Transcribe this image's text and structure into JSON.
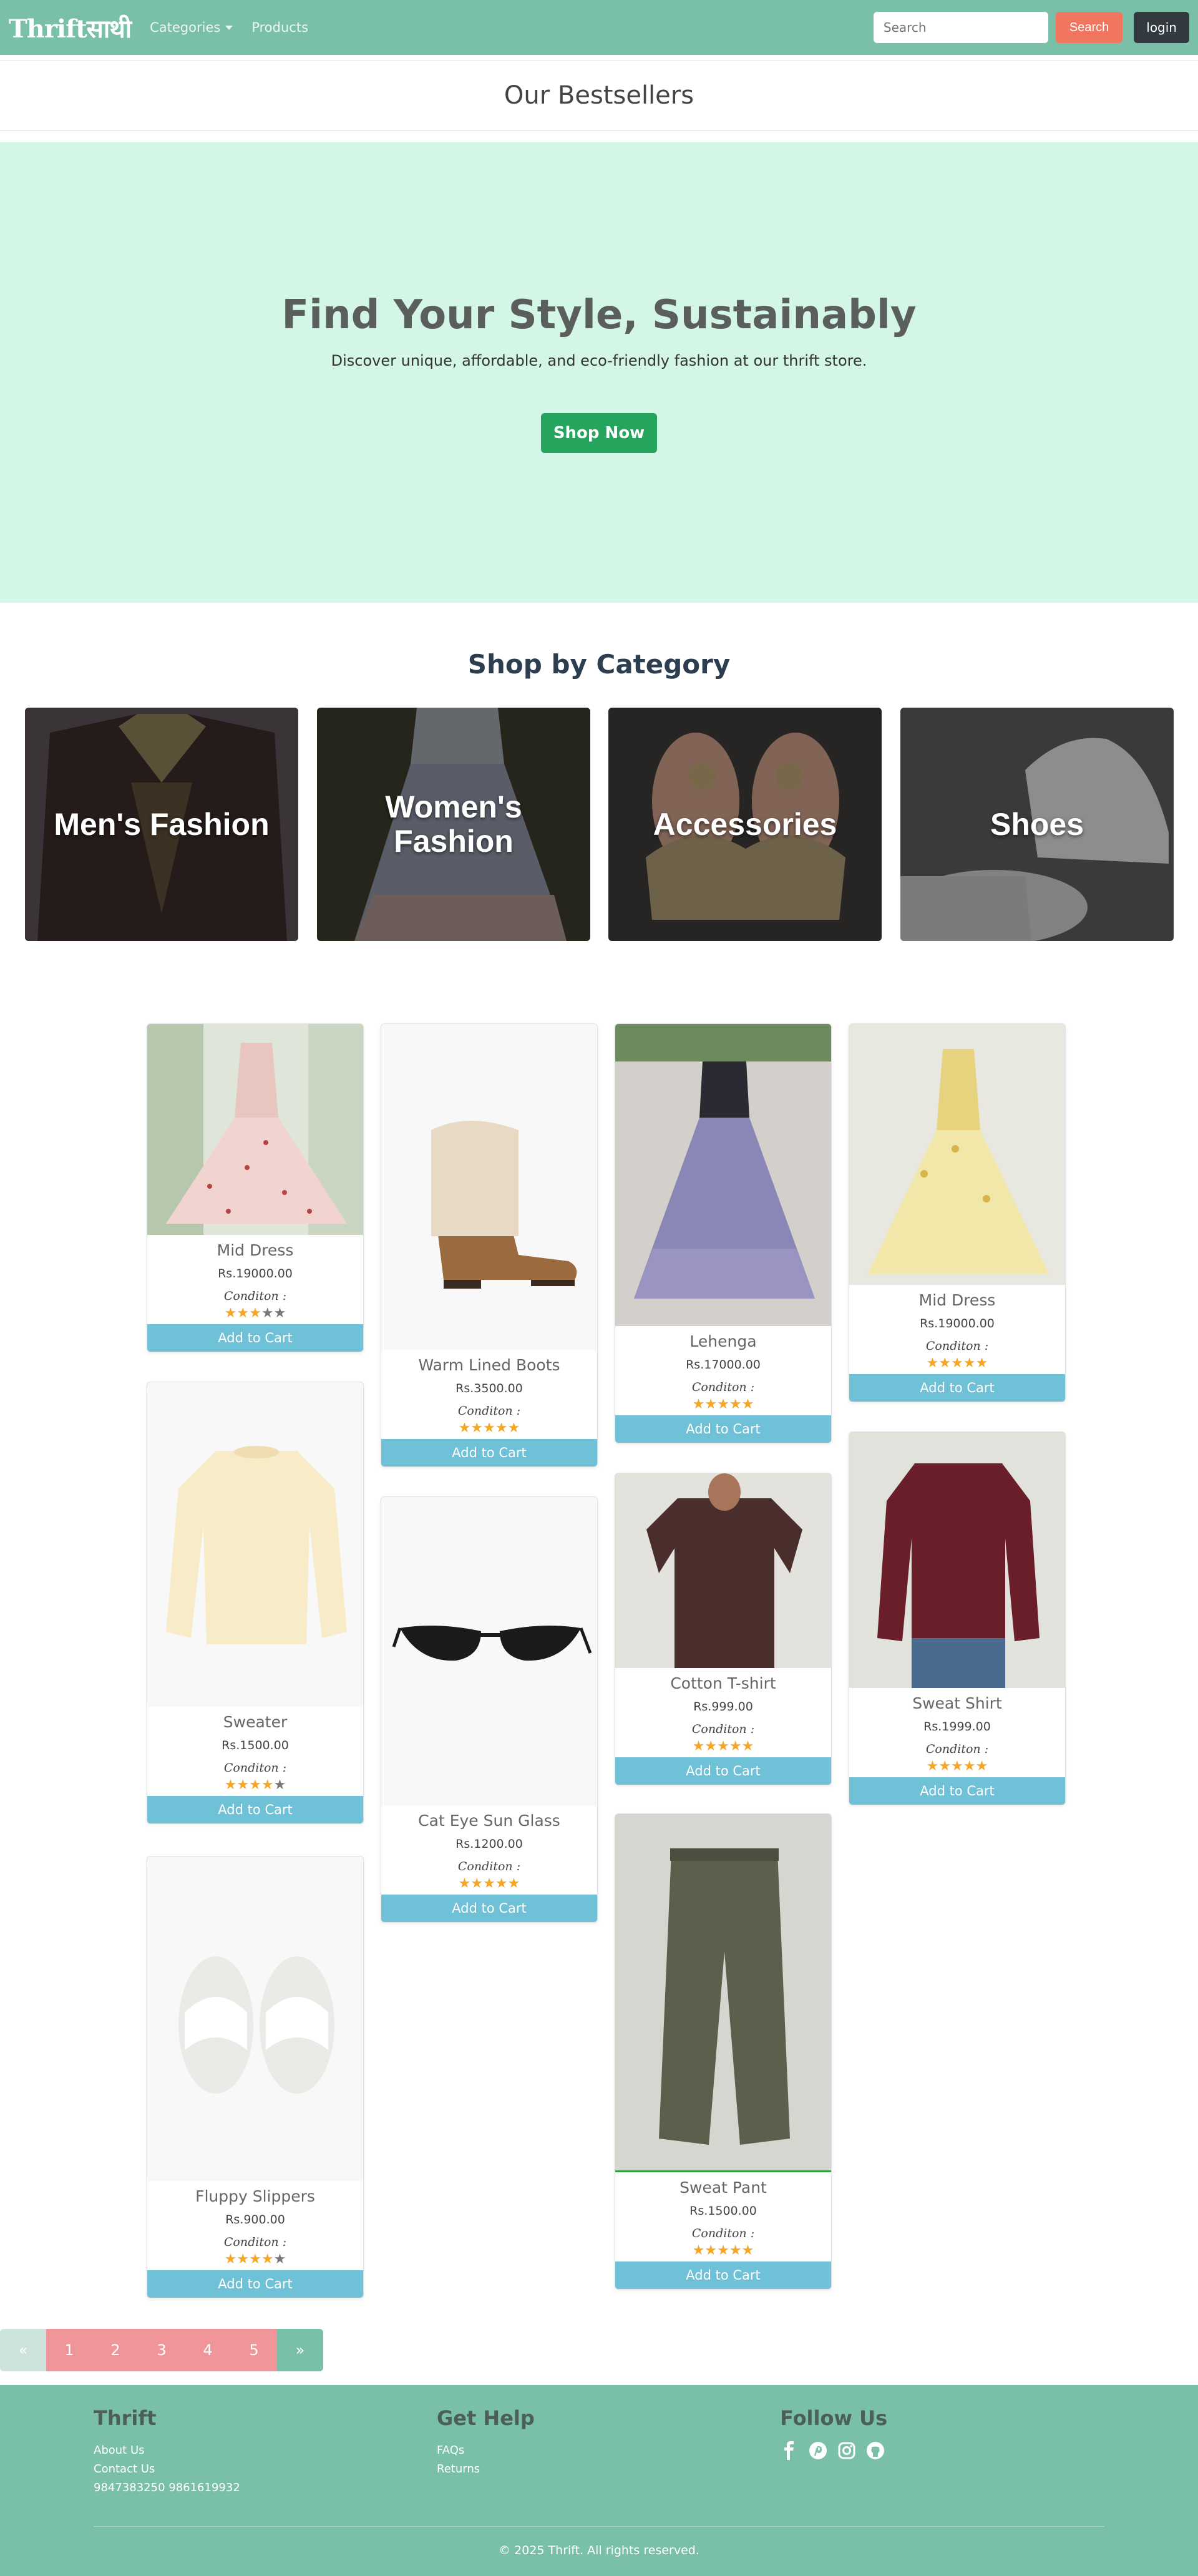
{
  "navbar": {
    "brand": "Thriftसाथी",
    "categories_label": "Categories",
    "products_label": "Products",
    "search_placeholder": "Search",
    "search_button": "Search",
    "login_button": "login"
  },
  "bestsellers_title": "Our Bestsellers",
  "hero": {
    "title": "Find Your Style, Sustainably",
    "subtitle": "Discover unique, affordable, and eco-friendly fashion at our thrift store.",
    "cta": "Shop Now"
  },
  "categories": {
    "title": "Shop by Category",
    "items": [
      {
        "label": "Men's Fashion",
        "icon": "jacket-photo"
      },
      {
        "label": "Women's Fashion",
        "icon": "lehenga-photo"
      },
      {
        "label": "Accessories",
        "icon": "earrings-photo"
      },
      {
        "label": "Shoes",
        "icon": "sneakers-photo"
      }
    ]
  },
  "products": [
    {
      "name": "Mid Dress",
      "price": "Rs.19000.00",
      "condition": "Conditon :",
      "rating": 3,
      "button": "Add to Cart"
    },
    {
      "name": "Sweater",
      "price": "Rs.1500.00",
      "condition": "Conditon :",
      "rating": 4,
      "button": "Add to Cart"
    },
    {
      "name": "Fluppy Slippers",
      "price": "Rs.900.00",
      "condition": "Conditon :",
      "rating": 4,
      "button": "Add to Cart"
    },
    {
      "name": "Warm Lined Boots",
      "price": "Rs.3500.00",
      "condition": "Conditon :",
      "rating": 5,
      "button": "Add to Cart"
    },
    {
      "name": "Cat Eye Sun Glass",
      "price": "Rs.1200.00",
      "condition": "Conditon :",
      "rating": 5,
      "button": "Add to Cart"
    },
    {
      "name": "Lehenga",
      "price": "Rs.17000.00",
      "condition": "Conditon :",
      "rating": 5,
      "button": "Add to Cart"
    },
    {
      "name": "Cotton T-shirt",
      "price": "Rs.999.00",
      "condition": "Conditon :",
      "rating": 5,
      "button": "Add to Cart"
    },
    {
      "name": "Sweat Pant",
      "price": "Rs.1500.00",
      "condition": "Conditon :",
      "rating": 5,
      "button": "Add to Cart"
    },
    {
      "name": "Mid Dress",
      "price": "Rs.19000.00",
      "condition": "Conditon :",
      "rating": 5,
      "button": "Add to Cart"
    },
    {
      "name": "Sweat Shirt",
      "price": "Rs.1999.00",
      "condition": "Conditon :",
      "rating": 5,
      "button": "Add to Cart"
    }
  ],
  "pagination": {
    "prev": "«",
    "pages": [
      "1",
      "2",
      "3",
      "4",
      "5"
    ],
    "next": "»"
  },
  "footer": {
    "col1": {
      "title": "Thrift",
      "links": [
        "About Us",
        "Contact Us",
        "9847383250 9861619932"
      ]
    },
    "col2": {
      "title": "Get Help",
      "links": [
        "FAQs",
        "Returns"
      ]
    },
    "col3": {
      "title": "Follow Us",
      "icons": [
        "facebook-icon",
        "pinterest-icon",
        "instagram-icon",
        "github-icon"
      ]
    },
    "copyright": "© 2025 Thrift. All rights reserved."
  },
  "colors": {
    "primary": "#7ac0a9",
    "hero_bg": "#d4f6e7",
    "search_button": "#f07660",
    "cart_button": "#6ec1d7",
    "shop_now": "#25a45e",
    "star": "#f5a623"
  }
}
